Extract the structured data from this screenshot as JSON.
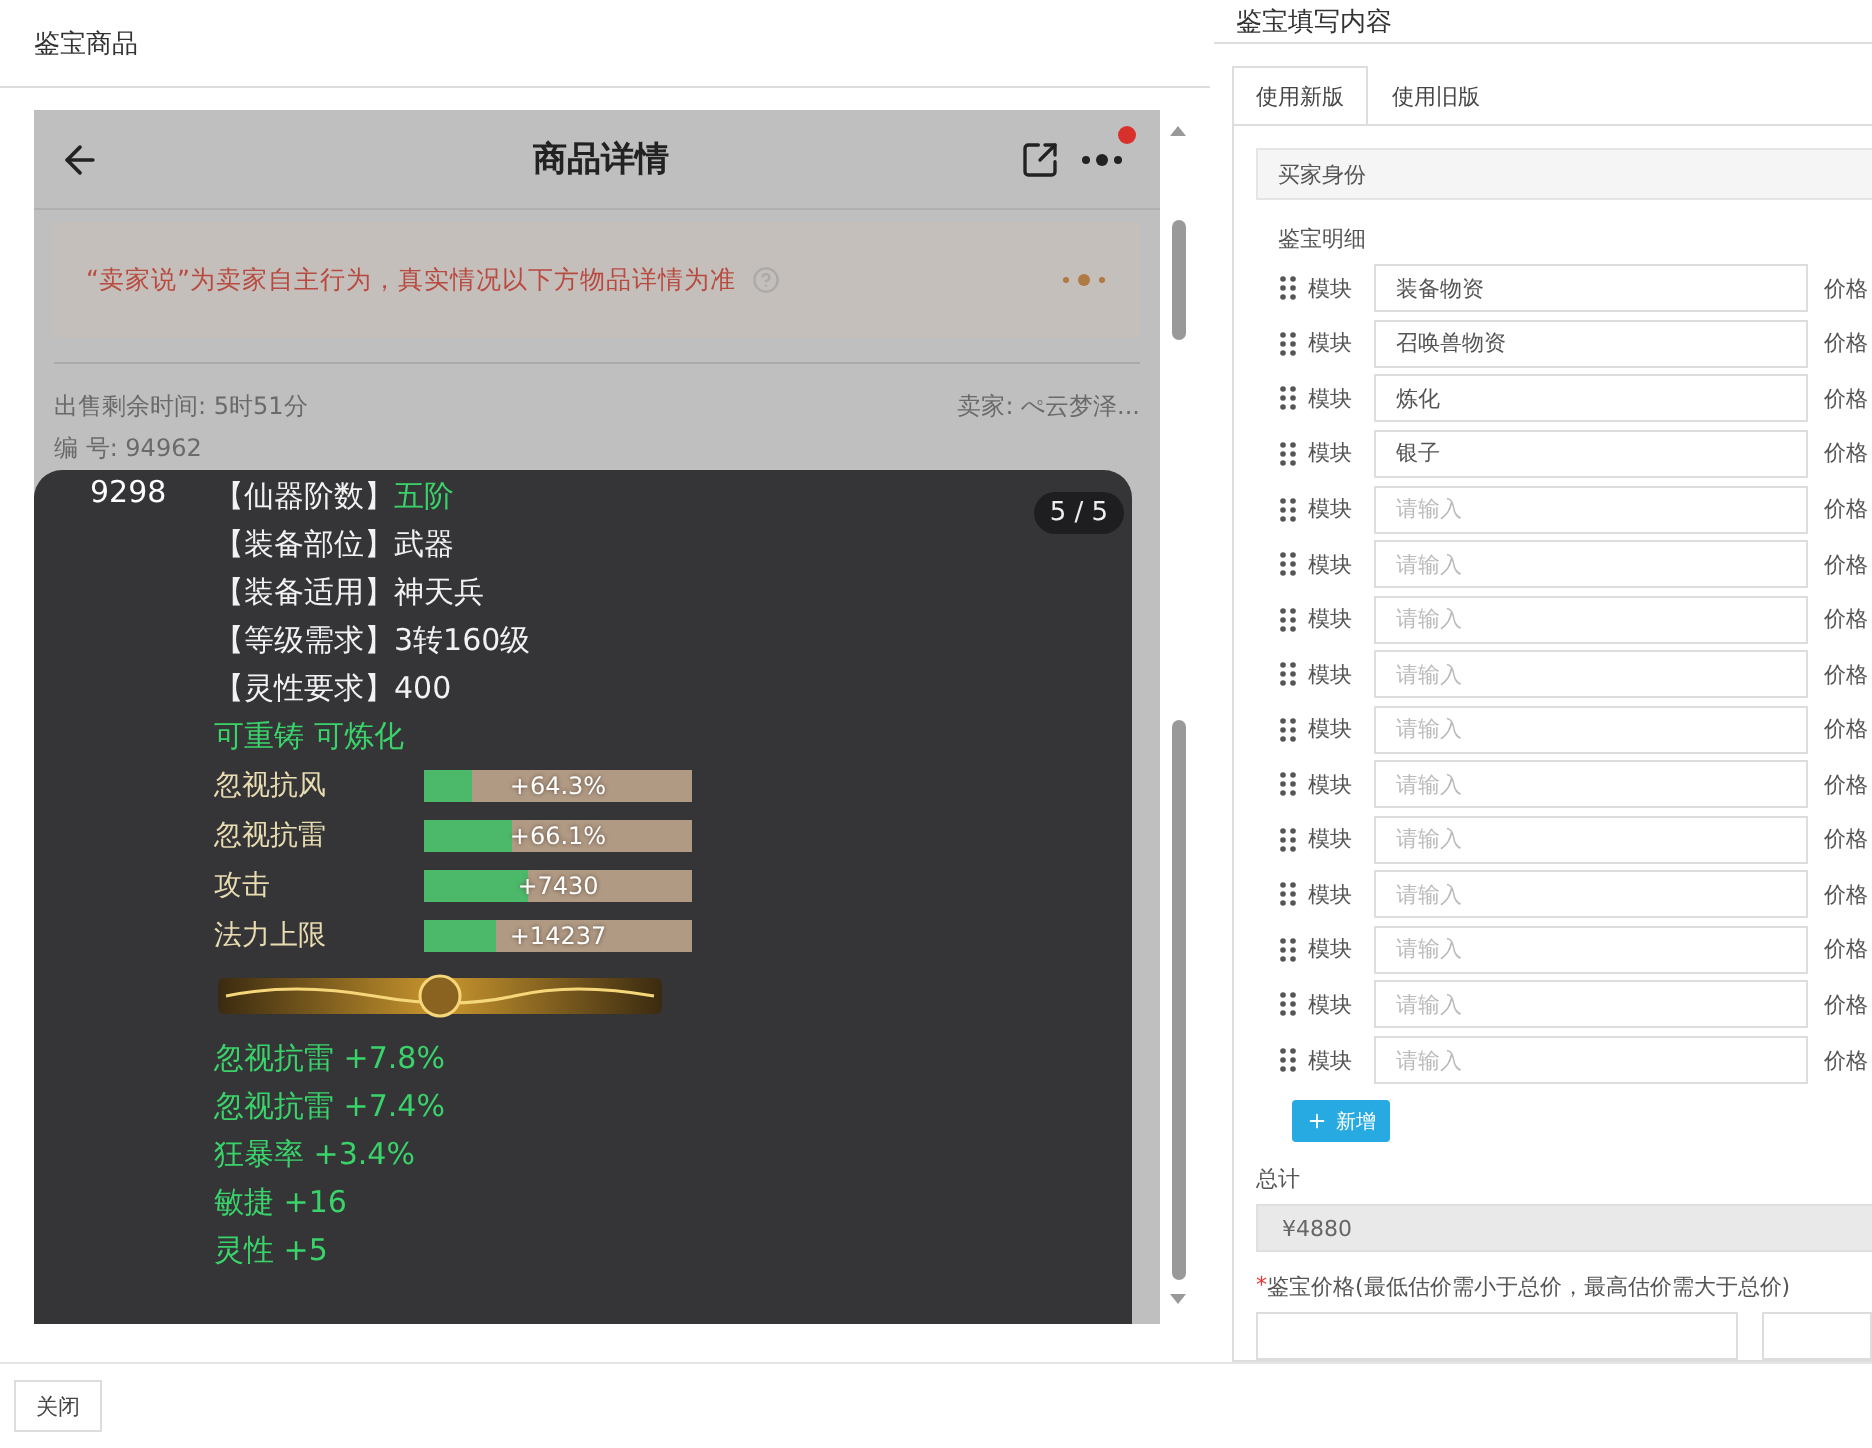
{
  "left_panel": {
    "title": "鉴宝商品"
  },
  "phone": {
    "title": "商品详情",
    "has_alert": true,
    "notice": "“卖家说”为卖家自主行为，真实情况以下方物品详情为准",
    "sale_time": "出售剩余时间: 5时51分",
    "seller": "卖家: ぺ云梦泽...",
    "serial": "编 号: 94962"
  },
  "viewer": {
    "counter": "5 / 5",
    "id_text": "9298",
    "attributes": [
      {
        "label": "【仙器阶数】",
        "value": "五阶",
        "highlight": true
      },
      {
        "label": "【装备部位】",
        "value": "武器",
        "highlight": false
      },
      {
        "label": "【装备适用】",
        "value": "神天兵",
        "highlight": false
      },
      {
        "label": "【等级需求】",
        "value": "3转160级",
        "highlight": false
      },
      {
        "label": "【灵性要求】",
        "value": "400",
        "highlight": false
      }
    ],
    "tags": "可重铸 可炼化",
    "stats": [
      {
        "label": "忽视抗风",
        "value": "+64.3%",
        "level": 0.18
      },
      {
        "label": "忽视抗雷",
        "value": "+66.1%",
        "level": 0.33
      },
      {
        "label": "攻击",
        "value": "+7430",
        "level": 0.39
      },
      {
        "label": "法力上限",
        "value": "+14237",
        "level": 0.27
      }
    ],
    "bonuses": [
      "忽视抗雷 +7.8%",
      "忽视抗雷 +7.4%",
      "狂暴率 +3.4%",
      "敏捷 +16",
      "灵性 +5"
    ]
  },
  "right_panel": {
    "title": "鉴宝填写内容",
    "tabs": [
      {
        "label": "使用新版",
        "selected": true
      },
      {
        "label": "使用旧版",
        "selected": false
      }
    ],
    "buyer_section": "买家身份",
    "detail_label": "鉴宝明细",
    "rows": [
      {
        "module": "模块",
        "value": "装备物资",
        "price": "价格"
      },
      {
        "module": "模块",
        "value": "召唤兽物资",
        "price": "价格"
      },
      {
        "module": "模块",
        "value": "炼化",
        "price": "价格"
      },
      {
        "module": "模块",
        "value": "银子",
        "price": "价格"
      },
      {
        "module": "模块",
        "placeholder": "请输入",
        "price": "价格"
      },
      {
        "module": "模块",
        "placeholder": "请输入",
        "price": "价格"
      },
      {
        "module": "模块",
        "placeholder": "请输入",
        "price": "价格"
      },
      {
        "module": "模块",
        "placeholder": "请输入",
        "price": "价格"
      },
      {
        "module": "模块",
        "placeholder": "请输入",
        "price": "价格"
      },
      {
        "module": "模块",
        "placeholder": "请输入",
        "price": "价格"
      },
      {
        "module": "模块",
        "placeholder": "请输入",
        "price": "价格"
      },
      {
        "module": "模块",
        "placeholder": "请输入",
        "price": "价格"
      },
      {
        "module": "模块",
        "placeholder": "请输入",
        "price": "价格"
      },
      {
        "module": "模块",
        "placeholder": "请输入",
        "price": "价格"
      },
      {
        "module": "模块",
        "placeholder": "请输入",
        "price": "价格"
      }
    ],
    "add_button": "新增",
    "total_label": "总计",
    "total_value": "¥4880",
    "price_label": "鉴宝价格(最低估价需小于总价，最高估价需大于总价)",
    "required_mark": "*"
  },
  "footer": {
    "close_button": "关闭"
  }
}
